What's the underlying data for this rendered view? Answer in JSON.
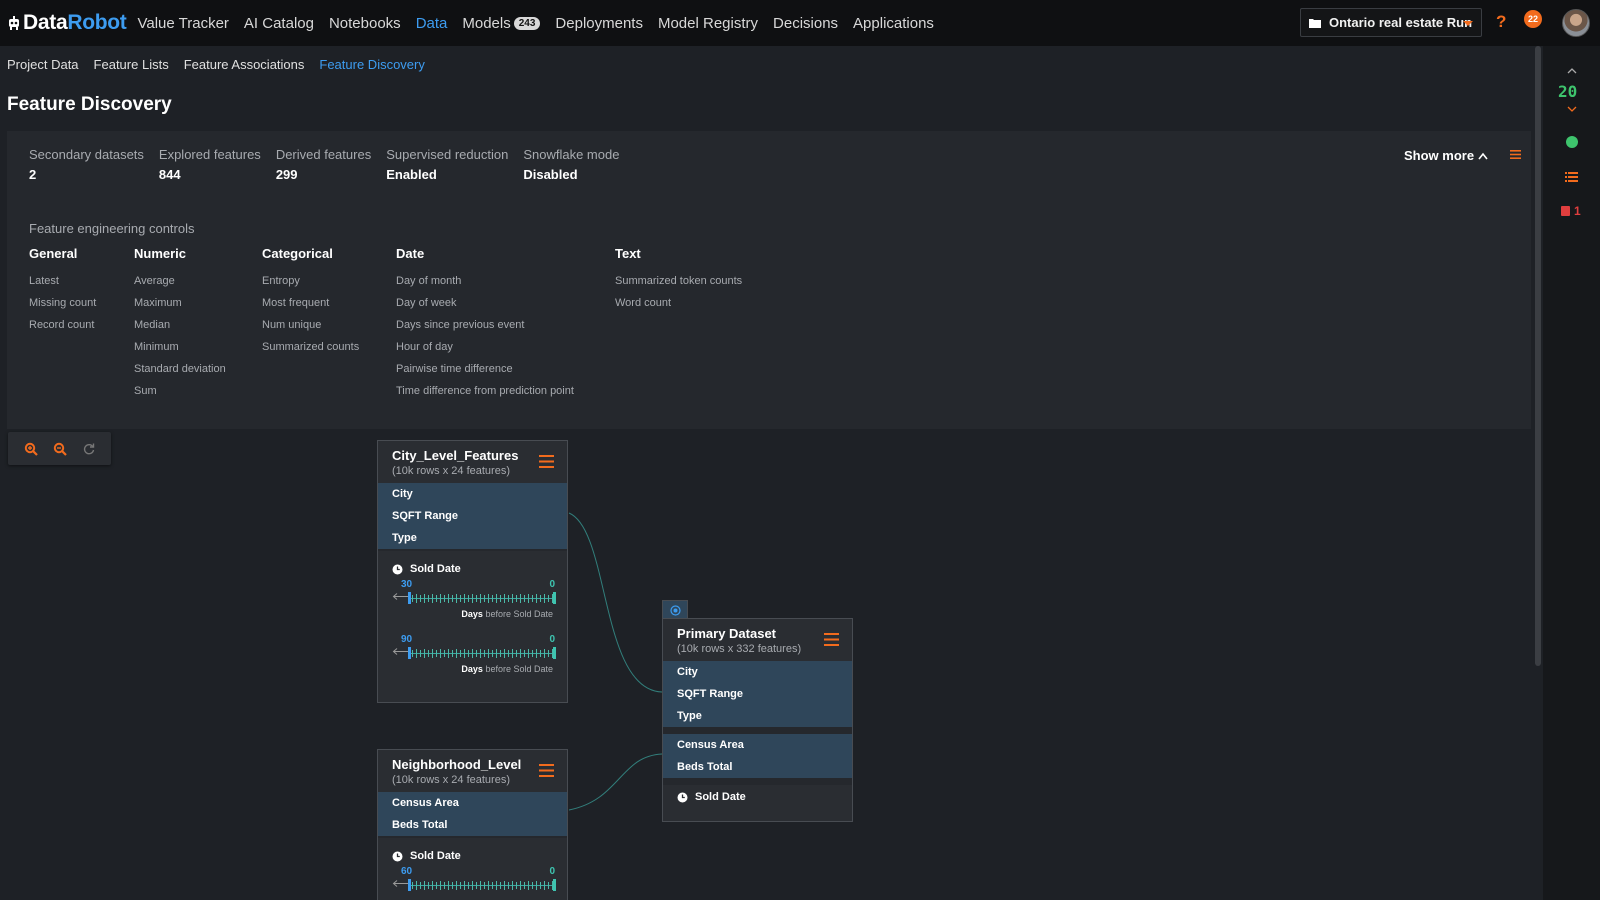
{
  "logo": {
    "part1": "Data",
    "part2": "Robot"
  },
  "nav": {
    "items": [
      {
        "label": "Value Tracker"
      },
      {
        "label": "AI Catalog"
      },
      {
        "label": "Notebooks"
      },
      {
        "label": "Data",
        "active": true
      },
      {
        "label": "Models",
        "badge": "243"
      },
      {
        "label": "Deployments"
      },
      {
        "label": "Model Registry"
      },
      {
        "label": "Decisions"
      },
      {
        "label": "Applications"
      }
    ],
    "project": "Ontario real estate Run",
    "help": "?",
    "notifications": "22"
  },
  "subtabs": [
    "Project Data",
    "Feature Lists",
    "Feature Associations",
    "Feature Discovery"
  ],
  "page_title": "Feature Discovery",
  "summary": {
    "stats": [
      {
        "label": "Secondary datasets",
        "value": "2"
      },
      {
        "label": "Explored features",
        "value": "844"
      },
      {
        "label": "Derived features",
        "value": "299"
      },
      {
        "label": "Supervised reduction",
        "value": "Enabled"
      },
      {
        "label": "Snowflake mode",
        "value": "Disabled"
      }
    ],
    "show_more": "Show more",
    "fe_title": "Feature engineering controls",
    "fe_columns": [
      {
        "head": "General",
        "items": [
          "Latest",
          "Missing count",
          "Record count"
        ]
      },
      {
        "head": "Numeric",
        "items": [
          "Average",
          "Maximum",
          "Median",
          "Minimum",
          "Standard deviation",
          "Sum"
        ]
      },
      {
        "head": "Categorical",
        "items": [
          "Entropy",
          "Most frequent",
          "Num unique",
          "Summarized counts"
        ]
      },
      {
        "head": "Date",
        "items": [
          "Day of month",
          "Day of week",
          "Days since previous event",
          "Hour of day",
          "Pairwise time difference",
          "Time difference from prediction point"
        ]
      },
      {
        "head": "Text",
        "items": [
          "Summarized token counts",
          "Word count"
        ]
      }
    ]
  },
  "rail": {
    "count": "20",
    "alerts": "1"
  },
  "graph": {
    "city": {
      "name": "City_Level_Features",
      "sub": "(10k rows x 24 features)",
      "features": [
        "City",
        "SQFT Range",
        "Type"
      ],
      "time_feature": "Sold Date",
      "windows": [
        {
          "from": "30",
          "to": "0",
          "unit": "Days",
          "caption": "before Sold Date"
        },
        {
          "from": "90",
          "to": "0",
          "unit": "Days",
          "caption": "before Sold Date"
        }
      ]
    },
    "neigh": {
      "name": "Neighborhood_Level",
      "sub": "(10k rows x 24 features)",
      "features": [
        "Census Area",
        "Beds Total"
      ],
      "time_feature": "Sold Date",
      "windows": [
        {
          "from": "60",
          "to": "0"
        }
      ]
    },
    "primary": {
      "name": "Primary Dataset",
      "sub": "(10k rows x 332 features)",
      "features_a": [
        "City",
        "SQFT Range",
        "Type"
      ],
      "features_b": [
        "Census Area",
        "Beds Total"
      ],
      "time_feature": "Sold Date"
    }
  },
  "colors": {
    "accent_orange": "#f26b1d",
    "accent_blue": "#3d9cf0",
    "status_green": "#3ec46d",
    "alert_red": "#e03e3e"
  }
}
